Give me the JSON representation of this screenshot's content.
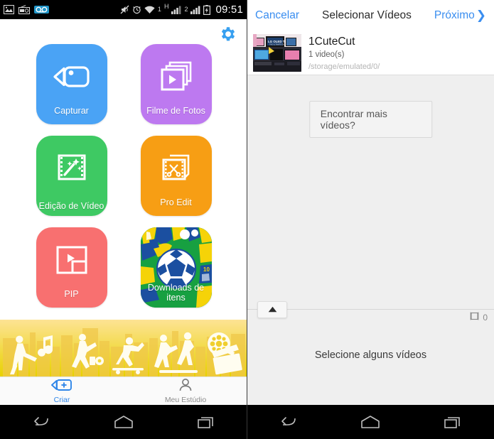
{
  "statusbar": {
    "icons": [
      "image-icon",
      "radio-icon",
      "voicemail-icon",
      "mute-icon",
      "alarm-icon",
      "wifi-icon",
      "network-h-icon",
      "signal-icon",
      "signal-icon",
      "battery-charging-icon"
    ],
    "sim1_label": "1",
    "network_type": "H",
    "sim2_label": "2",
    "clock": "09:51"
  },
  "left_app": {
    "settings_icon": "gear-icon",
    "tiles": [
      {
        "label": "Capturar",
        "color": "#4aa3f5",
        "icon": "video-camera-icon"
      },
      {
        "label": "Filme de Fotos",
        "color": "#bd79f0",
        "icon": "photo-stack-play-icon"
      },
      {
        "label": "Edição de Vídeo",
        "color": "#3ec963",
        "icon": "film-magic-wand-icon"
      },
      {
        "label": "Pro Edit",
        "color": "#f79e14",
        "icon": "film-scissors-icon"
      },
      {
        "label": "PIP",
        "color": "#f87070",
        "icon": "picture-in-picture-icon"
      },
      {
        "label": "Downloads de itens",
        "color": "#1b9b3e",
        "icon": "soccer-ball-icon"
      }
    ],
    "tabbar": [
      {
        "label": "Criar",
        "icon": "video-plus-icon",
        "active": true
      },
      {
        "label": "Meu Estúdio",
        "icon": "person-icon",
        "active": false
      }
    ],
    "banner_colors": {
      "top": "#fbe08a",
      "bottom": "#ead400"
    }
  },
  "right_app": {
    "header": {
      "cancel": "Cancelar",
      "title": "Selecionar Vídeos",
      "next": "Próximo",
      "next_icon": "chevron-right-icon",
      "accent": "#3a8ef0"
    },
    "folder": {
      "name": "1CuteCut",
      "count": "1 video(s)",
      "path": "/storage/emulated/0/",
      "thumbnail_icon": "video-thumbnail"
    },
    "find_more_label": "Encontrar mais vídeos?",
    "expand_icon": "triangle-up-icon",
    "clip_counter": {
      "icon": "film-frame-icon",
      "value": "0"
    },
    "select_hint": "Selecione alguns vídeos"
  },
  "system_nav": {
    "buttons": [
      {
        "name": "back",
        "icon": "back-arrow-icon"
      },
      {
        "name": "home",
        "icon": "home-icon"
      },
      {
        "name": "recents",
        "icon": "recents-icon"
      }
    ]
  }
}
